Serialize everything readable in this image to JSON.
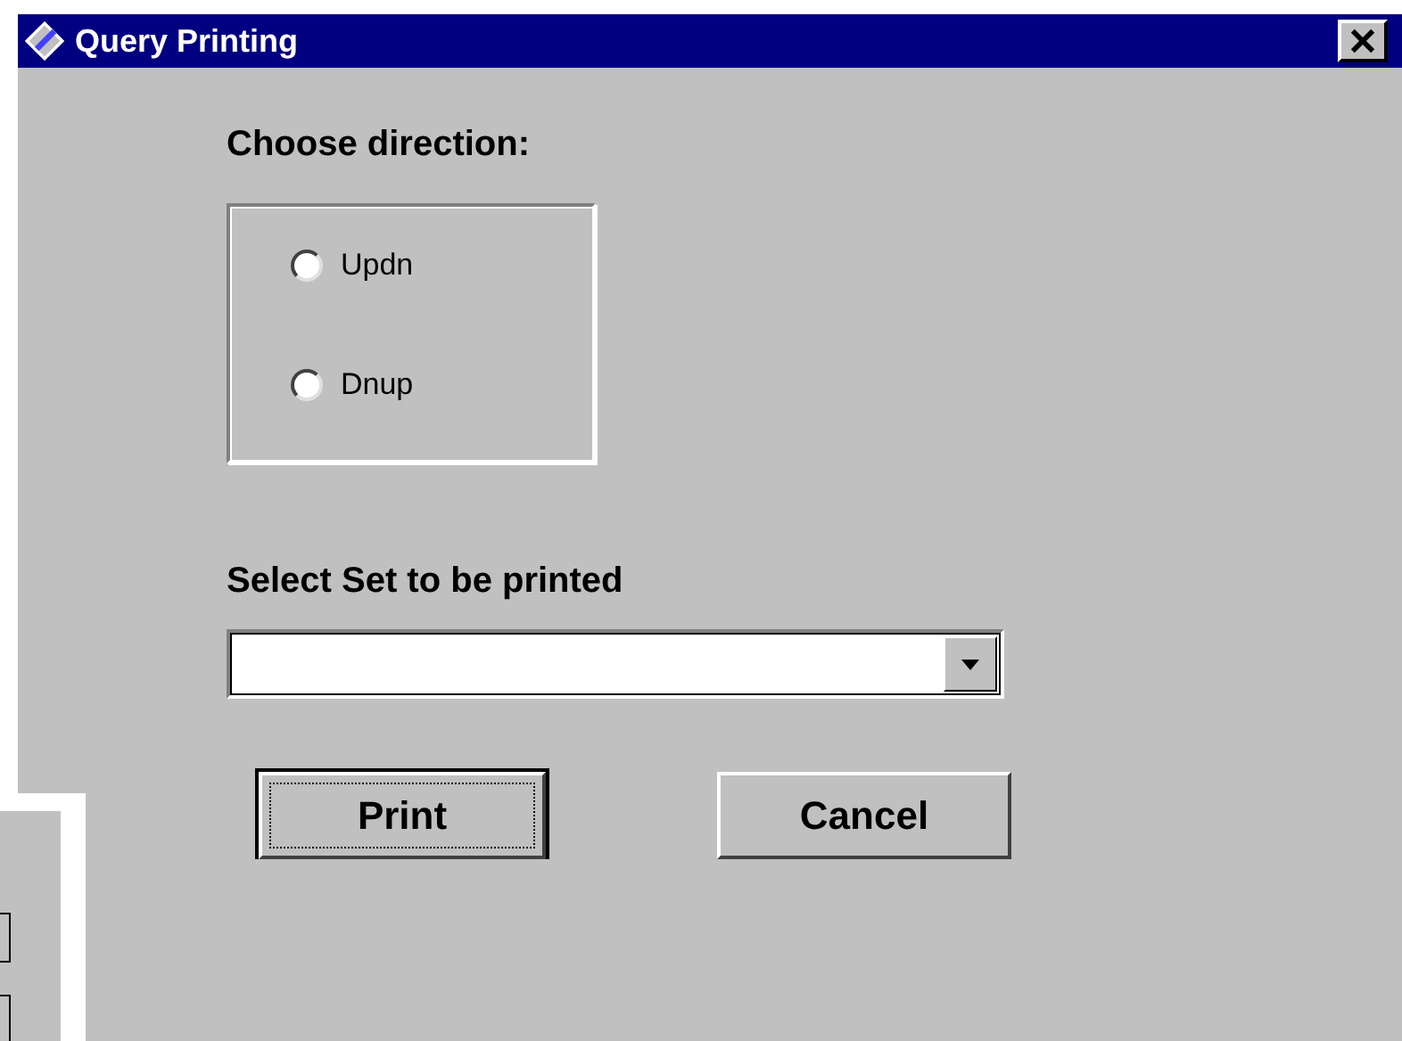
{
  "window": {
    "title": "Query Printing"
  },
  "direction": {
    "label": "Choose direction:",
    "options": [
      {
        "label": "Updn",
        "selected": false
      },
      {
        "label": "Dnup",
        "selected": false
      }
    ]
  },
  "set_select": {
    "label": "Select Set to be printed"
  },
  "buttons": [
    {
      "label": "Print",
      "default": true
    },
    {
      "label": "Cancel",
      "default": false
    }
  ]
}
